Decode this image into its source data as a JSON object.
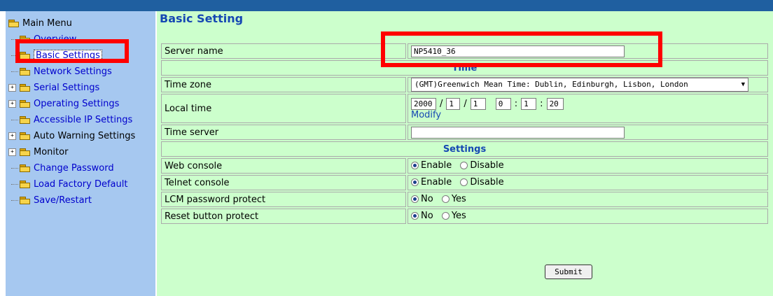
{
  "sidebar": {
    "root_label": "Main Menu",
    "items": [
      {
        "label": "Overview",
        "expandable": false
      },
      {
        "label": "Basic Settings",
        "expandable": false,
        "selected": true
      },
      {
        "label": "Network Settings",
        "expandable": false
      },
      {
        "label": "Serial Settings",
        "expandable": true
      },
      {
        "label": "Operating Settings",
        "expandable": true
      },
      {
        "label": "Accessible IP Settings",
        "expandable": false
      },
      {
        "label": "Auto Warning Settings",
        "expandable": true
      },
      {
        "label": "Monitor",
        "expandable": true
      },
      {
        "label": "Change Password",
        "expandable": false
      },
      {
        "label": "Load Factory Default",
        "expandable": false
      },
      {
        "label": "Save/Restart",
        "expandable": false
      }
    ]
  },
  "page_title": "Basic Setting",
  "form": {
    "server_name": {
      "label": "Server name",
      "value": "NP5410_36"
    },
    "time_section": "Time",
    "time_zone": {
      "label": "Time zone",
      "value": "(GMT)Greenwich Mean Time: Dublin, Edinburgh, Lisbon, London"
    },
    "local_time": {
      "label": "Local time",
      "year": "2000",
      "month": "1",
      "day": "1",
      "hour": "0",
      "minute": "1",
      "second": "20",
      "date_sep": "/",
      "time_sep": ":",
      "modify": "Modify"
    },
    "time_server": {
      "label": "Time server",
      "value": ""
    },
    "settings_section": "Settings",
    "web_console": {
      "label": "Web console",
      "opt1": "Enable",
      "opt2": "Disable",
      "selected": "Enable"
    },
    "telnet_console": {
      "label": "Telnet console",
      "opt1": "Enable",
      "opt2": "Disable",
      "selected": "Enable"
    },
    "lcm_password": {
      "label": "LCM password protect",
      "opt1": "No",
      "opt2": "Yes",
      "selected": "No"
    },
    "reset_button": {
      "label": "Reset button protect",
      "opt1": "No",
      "opt2": "Yes",
      "selected": "No"
    }
  },
  "submit_label": "Submit",
  "colors": {
    "sidebar_bg": "#a6c8f0",
    "content_bg": "#ccffcc",
    "topbar": "#1f5fa0",
    "highlight": "#ff0000",
    "link": "#1547b3"
  }
}
